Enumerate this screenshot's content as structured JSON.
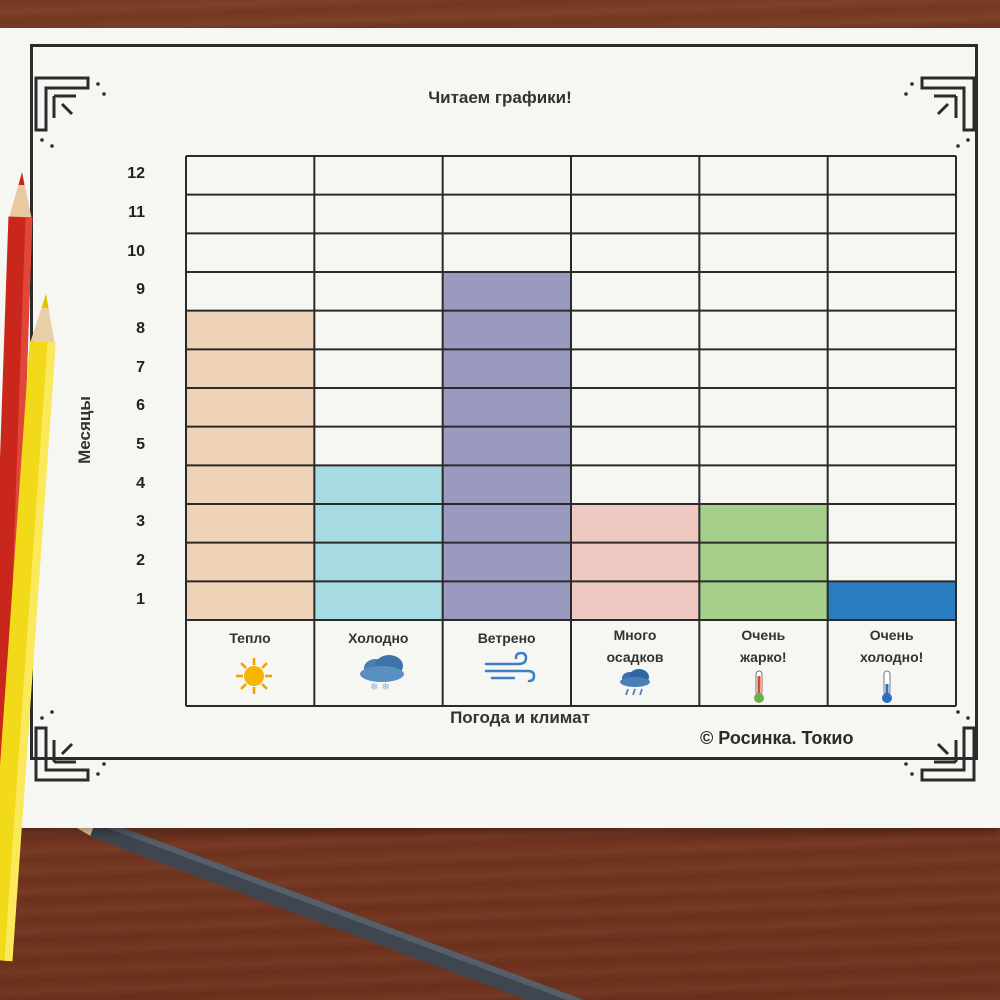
{
  "chart_data": {
    "type": "bar",
    "title": "Читаем графики!",
    "xlabel": "Погода и климат",
    "ylabel": "Месяцы",
    "ylim": [
      0,
      12
    ],
    "yticks": [
      "1",
      "2",
      "3",
      "4",
      "5",
      "6",
      "7",
      "8",
      "9",
      "10",
      "11",
      "12"
    ],
    "categories": [
      "Тепло",
      "Холодно",
      "Ветрено",
      "Много осадков",
      "Очень жарко!",
      "Очень холодно!"
    ],
    "values": [
      8,
      4,
      9,
      3,
      3,
      1
    ],
    "colors": [
      "#efd3b8",
      "#a6dbe2",
      "#9a9ac0",
      "#f0c8c2",
      "#a6cf8a",
      "#2a7cc0"
    ],
    "icons": [
      "sun-icon",
      "snow-cloud-icon",
      "wind-icon",
      "rain-cloud-icon",
      "hot-thermometer-icon",
      "cold-thermometer-icon"
    ],
    "grid": true
  },
  "category_lines": [
    [
      "Тепло"
    ],
    [
      "Холодно"
    ],
    [
      "Ветрено"
    ],
    [
      "Много",
      "осадков"
    ],
    [
      "Очень",
      "жарко!"
    ],
    [
      "Очень",
      "холодно!"
    ]
  ],
  "copyright": "© Росинка. Токио"
}
